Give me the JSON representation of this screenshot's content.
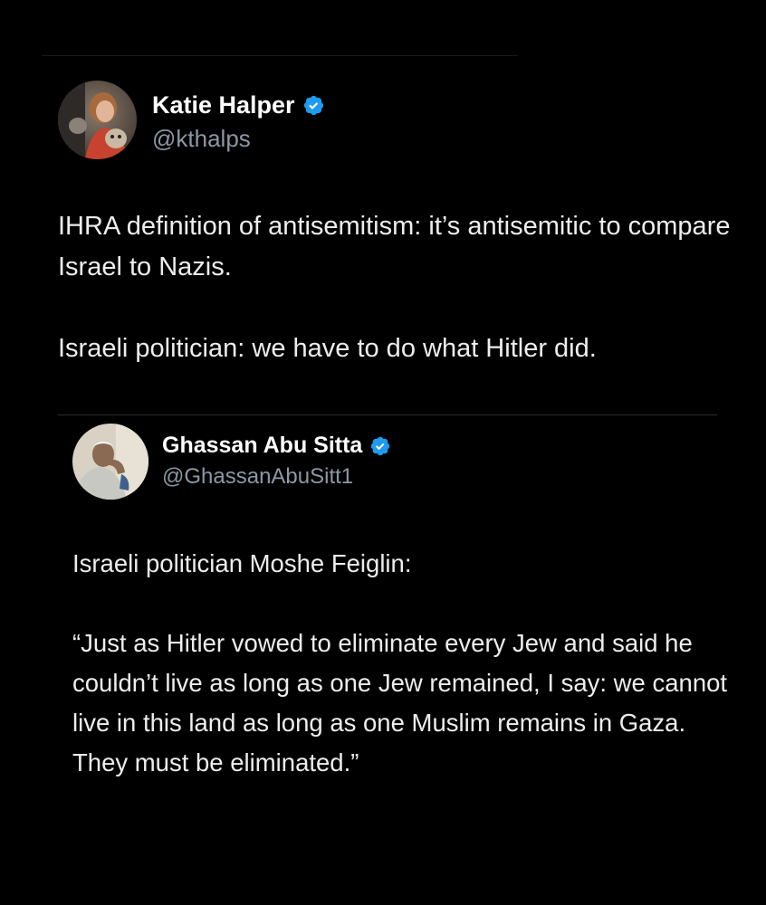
{
  "main_tweet": {
    "author_name": "Katie Halper",
    "handle": "@kthalps",
    "verified": true,
    "paragraphs": [
      "IHRA definition of antisemitism: it’s antisemitic to compare Israel to Nazis.",
      "Israeli politician: we have to do what Hitler did."
    ]
  },
  "quoted_tweet": {
    "author_name": "Ghassan Abu Sitta",
    "handle": "@GhassanAbuSitt1",
    "verified": true,
    "paragraphs": [
      "Israeli politician Moshe Feiglin:",
      "“Just as Hitler vowed to eliminate every Jew and said he couldn’t live as long as one Jew remained, I say: we cannot live in this land as long as one Muslim remains in Gaza. They must be eliminated.”"
    ]
  },
  "icons": {
    "verified": "verified-badge-icon"
  },
  "colors": {
    "background": "#000000",
    "text": "#e7e9ea",
    "secondary_text": "#8b98a5",
    "verified_blue": "#1d9bf0"
  }
}
